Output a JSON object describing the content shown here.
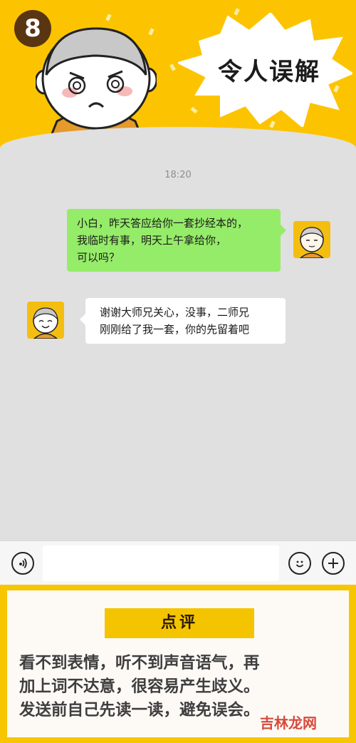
{
  "header": {
    "badge_number": "8",
    "title": "令人误解"
  },
  "chat": {
    "timestamp": "18:20",
    "messages": [
      {
        "side": "right",
        "lines": [
          "小白，昨天答应给你一套抄经本的，",
          "我临时有事，明天上午拿给你，",
          "可以吗？"
        ]
      },
      {
        "side": "left",
        "lines": [
          "谢谢大师兄关心，没事，二师兄",
          "刚刚给了我一套，你的先留着吧"
        ]
      }
    ]
  },
  "input_bar": {
    "value": "",
    "icons": [
      "voice-icon",
      "emoji-icon",
      "plus-icon"
    ]
  },
  "review": {
    "tag": "点评",
    "lines": [
      "看不到表情，听不到声音语气，再",
      "加上词不达意，很容易产生歧义。",
      "发送前自己先读一读，避免误会。"
    ]
  },
  "watermark": "吉林龙网",
  "colors": {
    "header_yellow": "#fcc400",
    "chat_bg": "#e0e0e0",
    "bubble_green": "#95ec69",
    "bubble_white": "#ffffff",
    "badge_brown": "#5a3512"
  }
}
